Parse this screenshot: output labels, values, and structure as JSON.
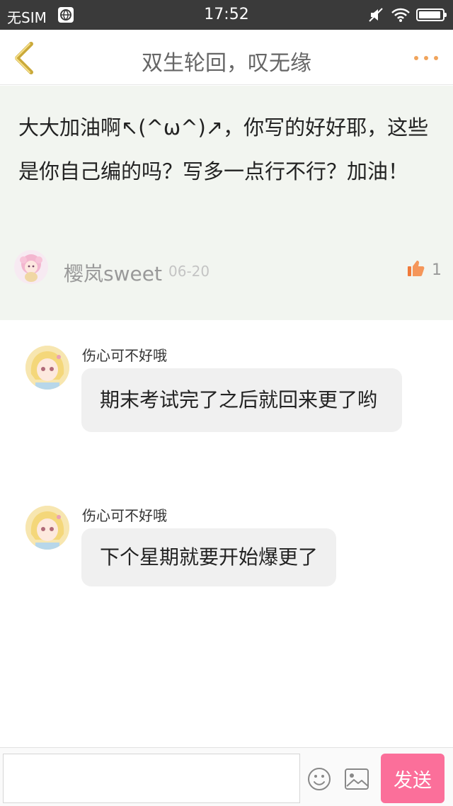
{
  "status_bar": {
    "carrier": "无SIM",
    "time": "17:52",
    "battery_level": 0.95,
    "icons": [
      "globe-icon",
      "mute-icon",
      "wifi-icon",
      "battery-icon"
    ]
  },
  "nav": {
    "title": "双生轮回，叹无缘",
    "back_icon": "chevron-left-icon",
    "more_icon": "more-dots-icon",
    "accent_color": "#f0a45c"
  },
  "comment": {
    "text": "大大加油啊↖(^ω^)↗，你写的好好耶，这些是你自己编的吗？写多一点行不行？加油！",
    "author": "樱岚sweet",
    "date": "06-20",
    "like_icon": "thumbs-up-icon",
    "like_count": "1",
    "background_color": "#f2f5f0"
  },
  "replies": [
    {
      "author": "伤心可不好哦",
      "text": "期末考试完了之后就回来更了哟"
    },
    {
      "author": "伤心可不好哦",
      "text": "下个星期就要开始爆更了"
    }
  ],
  "input_bar": {
    "placeholder": "",
    "emoji_icon": "emoji-icon",
    "image_icon": "image-icon",
    "send_label": "发送",
    "send_color": "#fb6f9a"
  }
}
